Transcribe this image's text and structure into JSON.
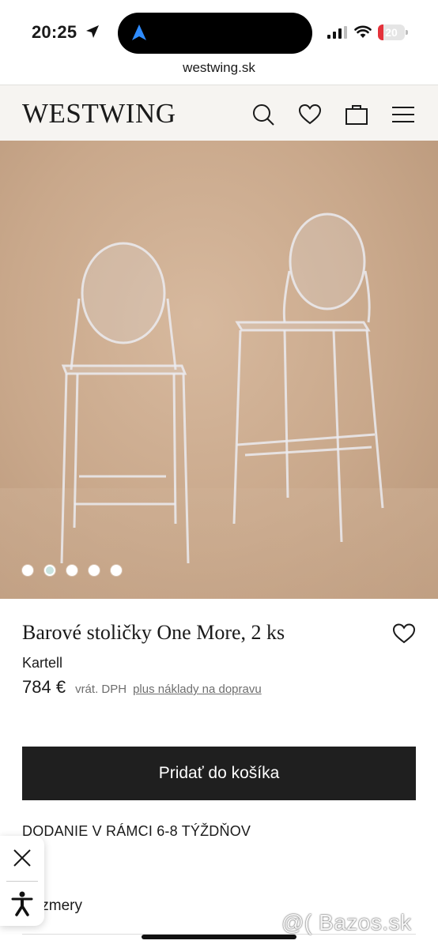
{
  "status_bar": {
    "time": "20:25",
    "battery_percent": 20,
    "battery_label": "20",
    "battery_color": "#e4323b",
    "icons": [
      "location-arrow-icon",
      "navigation-icon",
      "signal-icon",
      "wifi-icon",
      "battery-icon"
    ]
  },
  "browser": {
    "url": "westwing.sk"
  },
  "header": {
    "logo": "WESTWING",
    "icons": [
      "search-icon",
      "heart-icon",
      "bag-icon",
      "menu-icon"
    ]
  },
  "gallery": {
    "image_count": 5,
    "active_index": 1,
    "active_color": "#c9e3df"
  },
  "product": {
    "title": "Barové stoličky One More, 2 ks",
    "brand": "Kartell",
    "price": "784 €",
    "vat_note": "vrát. DPH",
    "shipping_link": "plus náklady na dopravu"
  },
  "actions": {
    "add_to_cart": "Pridať do košíka"
  },
  "delivery": {
    "text": "DODANIE V RÁMCI 6-8 TÝŽDŇOV"
  },
  "sections": {
    "dimensions": "Rozmery"
  },
  "widget": {
    "icons": [
      "close-icon",
      "accessibility-icon"
    ]
  },
  "watermark": "@( Bazos.sk"
}
